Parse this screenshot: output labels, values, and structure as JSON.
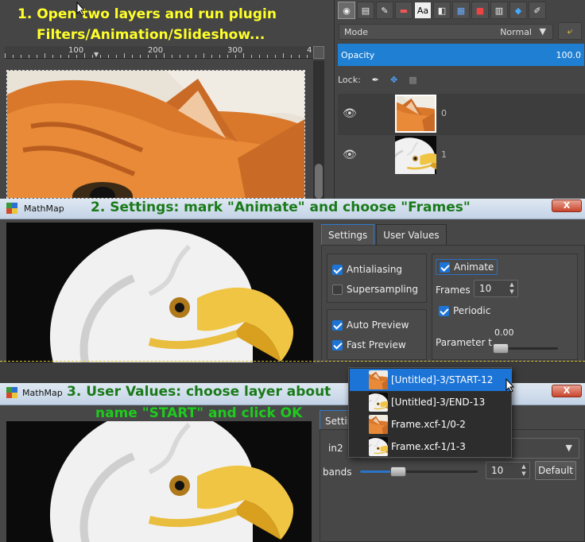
{
  "captions": {
    "step1_line1": "1. Open two layers and run plugin",
    "step1_line2": "Filters/Animation/Slideshow...",
    "step2": "2. Settings: mark \"Animate\" and choose \"Frames\"",
    "step3_line1": "3. User Values: choose layer about",
    "step3_line2": "name \"START\" and click OK"
  },
  "gimp": {
    "ruler_labels": [
      "100",
      "200",
      "300",
      "4"
    ],
    "mode_label": "Mode",
    "mode_value": "Normal",
    "opacity_label": "Opacity",
    "opacity_value": "100.0",
    "lock_label": "Lock:",
    "layers": [
      {
        "name": "0",
        "thumb": "cat-icon"
      },
      {
        "name": "1",
        "thumb": "eagle-icon"
      }
    ]
  },
  "mathmap": {
    "title": "MathMap",
    "close_label": "X",
    "tabs": [
      "Settings",
      "User Values"
    ],
    "settings": {
      "antialiasing": "Antialiasing",
      "supersampling": "Supersampling",
      "auto_preview": "Auto Preview",
      "fast_preview": "Fast Preview",
      "animate": "Animate",
      "frames_label": "Frames",
      "frames_value": "10",
      "periodic": "Periodic",
      "parameter_label": "Parameter t",
      "parameter_value": "0.00",
      "checked": {
        "antialiasing": true,
        "supersampling": false,
        "auto_preview": true,
        "fast_preview": true,
        "animate": true,
        "periodic": true
      }
    }
  },
  "mathmap3": {
    "title": "MathMap",
    "close_label": "X",
    "tab_partial": "Settin",
    "in2_label": "in2",
    "bands_label": "bands",
    "bands_value": "10",
    "bands_level": 0.3,
    "default_label": "Default",
    "dropdown": [
      {
        "label": "[Untitled]-3/START-12",
        "thumb": "cat-icon",
        "selected": true
      },
      {
        "label": "[Untitled]-3/END-13",
        "thumb": "eagle-icon",
        "selected": false
      },
      {
        "label": "Frame.xcf-1/0-2",
        "thumb": "cat-icon",
        "selected": false
      },
      {
        "label": "Frame.xcf-1/1-3",
        "thumb": "eagle-icon",
        "selected": false
      }
    ]
  },
  "colors": {
    "accent": "#1c74d6",
    "caption_yellow": "#ffff2a",
    "caption_green": "#1a7a1a"
  }
}
